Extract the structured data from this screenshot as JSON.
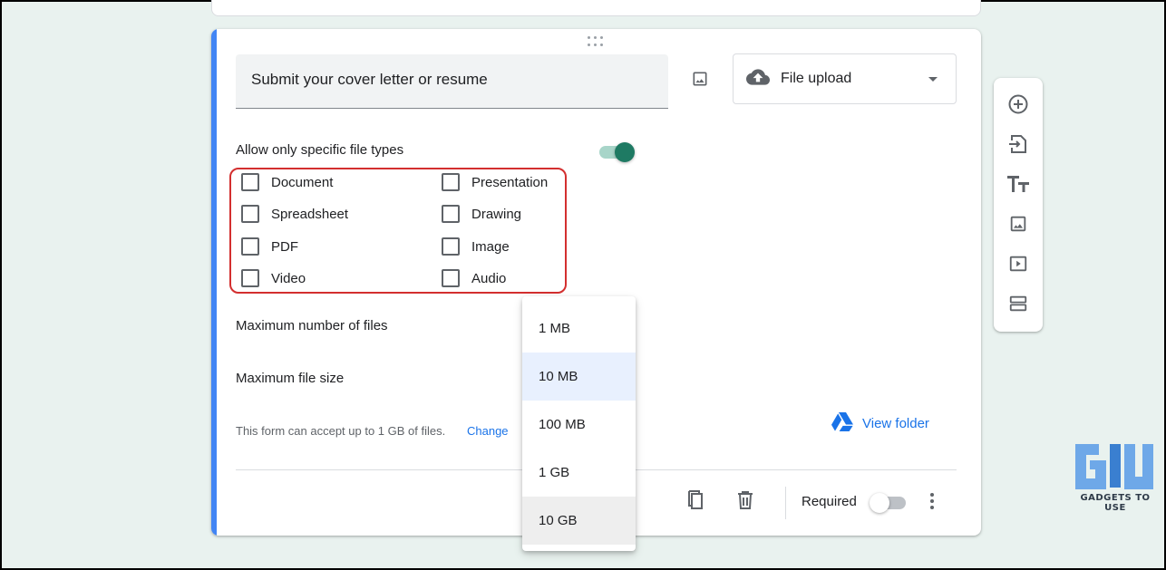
{
  "question": {
    "title": "Submit your cover letter or resume",
    "type": "File upload",
    "type_icon": "cloud-upload-icon",
    "image_icon": "image-icon"
  },
  "settings": {
    "allow_specific_types_label": "Allow only specific file types",
    "allow_specific_types_enabled": true,
    "file_types": [
      {
        "label": "Document",
        "checked": false
      },
      {
        "label": "Presentation",
        "checked": false
      },
      {
        "label": "Spreadsheet",
        "checked": false
      },
      {
        "label": "Drawing",
        "checked": false
      },
      {
        "label": "PDF",
        "checked": false
      },
      {
        "label": "Image",
        "checked": false
      },
      {
        "label": "Video",
        "checked": false
      },
      {
        "label": "Audio",
        "checked": false
      }
    ],
    "max_files_label": "Maximum number of files",
    "max_size_label": "Maximum file size",
    "accept_note": "This form can accept up to 1 GB of files.",
    "change_link": "Change",
    "view_folder": "View folder"
  },
  "footer": {
    "required_label": "Required",
    "required_enabled": false
  },
  "size_dropdown": {
    "options": [
      "1 MB",
      "10 MB",
      "100 MB",
      "1 GB",
      "10 GB"
    ],
    "selected": "10 MB",
    "hovered": "10 GB"
  },
  "toolbar": {
    "items": [
      "add-question-icon",
      "import-questions-icon",
      "add-title-icon",
      "add-image-icon",
      "add-video-icon",
      "add-section-icon"
    ]
  },
  "watermark": {
    "text": "GADGETS TO USE"
  },
  "colors": {
    "accent": "#4285f4",
    "toggle_on": "#1e7a63",
    "highlight_border": "#d32f2f",
    "link": "#1a73e8",
    "selected_option": "#e8f0fe"
  }
}
